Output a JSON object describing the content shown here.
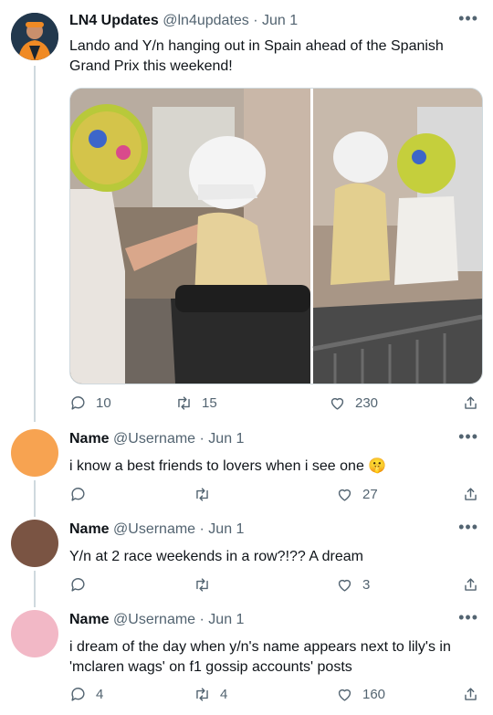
{
  "tweets": [
    {
      "name": "LN4 Updates",
      "handle": "@ln4updates",
      "date": "· Jun 1",
      "text": "Lando and Y/n hanging out in Spain ahead of the Spanish Grand Prix this weekend!",
      "replies": "10",
      "retweets": "15",
      "likes": "230",
      "avatar_color": "#1b2a3a"
    },
    {
      "name": "Name",
      "handle": "@Username",
      "date": "· Jun 1",
      "text": "i know a best friends to lovers when i see one 🤫",
      "replies": "",
      "retweets": "",
      "likes": "27",
      "avatar_color": "#f7a351"
    },
    {
      "name": "Name",
      "handle": "@Username",
      "date": "· Jun 1",
      "text": "Y/n at 2 race weekends in a row?!?? A dream",
      "replies": "",
      "retweets": "",
      "likes": "3",
      "avatar_color": "#7a5443"
    },
    {
      "name": "Name",
      "handle": "@Username",
      "date": "· Jun 1",
      "text": "i dream of the day when y/n's name appears next to lily's in 'mclaren wags' on f1 gossip accounts' posts",
      "replies": "4",
      "retweets": "4",
      "likes": "160",
      "avatar_color": "#f2b8c6"
    }
  ],
  "icons": {
    "more": "more-icon",
    "reply": "reply-icon",
    "retweet": "retweet-icon",
    "like": "heart-icon",
    "share": "share-icon"
  }
}
